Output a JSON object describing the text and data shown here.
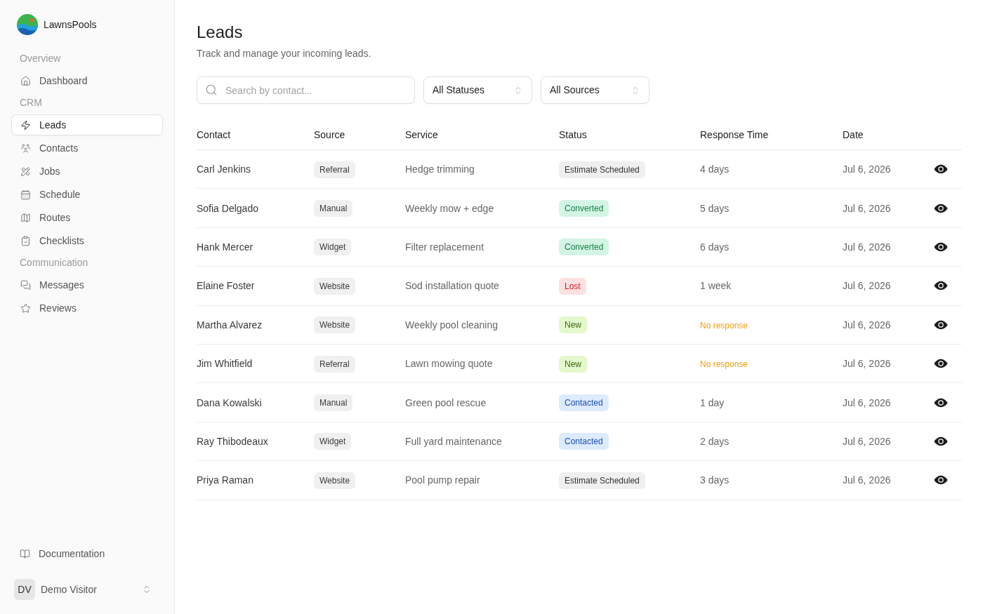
{
  "sidebar": {
    "brand": "LawnsPools",
    "sections": [
      {
        "label": "Overview",
        "items": [
          {
            "label": "Dashboard",
            "selected": false
          }
        ]
      },
      {
        "label": "CRM",
        "items": [
          {
            "label": "Leads",
            "selected": true
          },
          {
            "label": "Contacts",
            "selected": false
          },
          {
            "label": "Jobs",
            "selected": false
          },
          {
            "label": "Schedule",
            "selected": false
          },
          {
            "label": "Routes",
            "selected": false
          },
          {
            "label": "Checklists",
            "selected": false
          }
        ]
      },
      {
        "label": "Communication",
        "items": [
          {
            "label": "Messages",
            "selected": false
          },
          {
            "label": "Reviews",
            "selected": false
          }
        ]
      }
    ],
    "footer_link": {
      "label": "Documentation"
    },
    "user": {
      "initials": "DV",
      "name": "Demo Visitor"
    }
  },
  "header": {
    "title": "Leads",
    "subtitle": "Track and manage your incoming leads."
  },
  "filters": {
    "search": {
      "placeholder": "Search by contact..."
    },
    "selects": [
      {
        "value": "All Statuses"
      },
      {
        "value": "All Sources"
      }
    ]
  },
  "table": {
    "columns": [
      "Contact",
      "Source",
      "Service",
      "Status",
      "Response Time",
      "Date"
    ],
    "rows": [
      {
        "contact": "Carl Jenkins",
        "source": "Referral",
        "service": "Hedge trimming",
        "status": {
          "label": "Estimate Scheduled",
          "kind": "estimate"
        },
        "response": {
          "text": "4 days",
          "kind": "time"
        },
        "date": "Jul 6, 2026"
      },
      {
        "contact": "Sofia Delgado",
        "source": "Manual",
        "service": "Weekly mow + edge",
        "status": {
          "label": "Converted",
          "kind": "converted"
        },
        "response": {
          "text": "5 days",
          "kind": "time"
        },
        "date": "Jul 6, 2026"
      },
      {
        "contact": "Hank Mercer",
        "source": "Widget",
        "service": "Filter replacement",
        "status": {
          "label": "Converted",
          "kind": "converted"
        },
        "response": {
          "text": "6 days",
          "kind": "time"
        },
        "date": "Jul 6, 2026"
      },
      {
        "contact": "Elaine Foster",
        "source": "Website",
        "service": "Sod installation quote",
        "status": {
          "label": "Lost",
          "kind": "lost"
        },
        "response": {
          "text": "1 week",
          "kind": "time"
        },
        "date": "Jul 6, 2026"
      },
      {
        "contact": "Martha Alvarez",
        "source": "Website",
        "service": "Weekly pool cleaning",
        "status": {
          "label": "New",
          "kind": "new"
        },
        "response": {
          "text": "No response",
          "kind": "none"
        },
        "date": "Jul 6, 2026"
      },
      {
        "contact": "Jim Whitfield",
        "source": "Referral",
        "service": "Lawn mowing quote",
        "status": {
          "label": "New",
          "kind": "new"
        },
        "response": {
          "text": "No response",
          "kind": "none"
        },
        "date": "Jul 6, 2026"
      },
      {
        "contact": "Dana Kowalski",
        "source": "Manual",
        "service": "Green pool rescue",
        "status": {
          "label": "Contacted",
          "kind": "contacted"
        },
        "response": {
          "text": "1 day",
          "kind": "time"
        },
        "date": "Jul 6, 2026"
      },
      {
        "contact": "Ray Thibodeaux",
        "source": "Widget",
        "service": "Full yard maintenance",
        "status": {
          "label": "Contacted",
          "kind": "contacted"
        },
        "response": {
          "text": "2 days",
          "kind": "time"
        },
        "date": "Jul 6, 2026"
      },
      {
        "contact": "Priya Raman",
        "source": "Website",
        "service": "Pool pump repair",
        "status": {
          "label": "Estimate Scheduled",
          "kind": "estimate"
        },
        "response": {
          "text": "3 days",
          "kind": "time"
        },
        "date": "Jul 6, 2026"
      }
    ]
  }
}
